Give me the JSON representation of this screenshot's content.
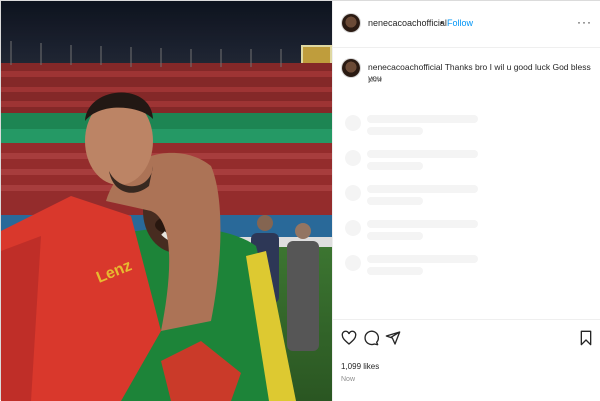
{
  "header": {
    "username": "nenecacoachofficial",
    "separator": "•",
    "follow_label": "Follow",
    "more_label": "···"
  },
  "caption": {
    "username": "nenecacoachofficial",
    "text": "Thanks bro I wil u good luck God bless you",
    "time": "Now"
  },
  "photo": {
    "jersey_text": "Lenz"
  },
  "actions": {
    "icons": [
      "heart-icon",
      "comment-icon",
      "share-icon",
      "bookmark-icon"
    ],
    "likes": "1,099 likes",
    "time": "Now"
  },
  "colors": {
    "follow": "#0095f6",
    "text": "#262626",
    "muted": "#8e8e8e",
    "skeleton": "#f4f4f4"
  }
}
